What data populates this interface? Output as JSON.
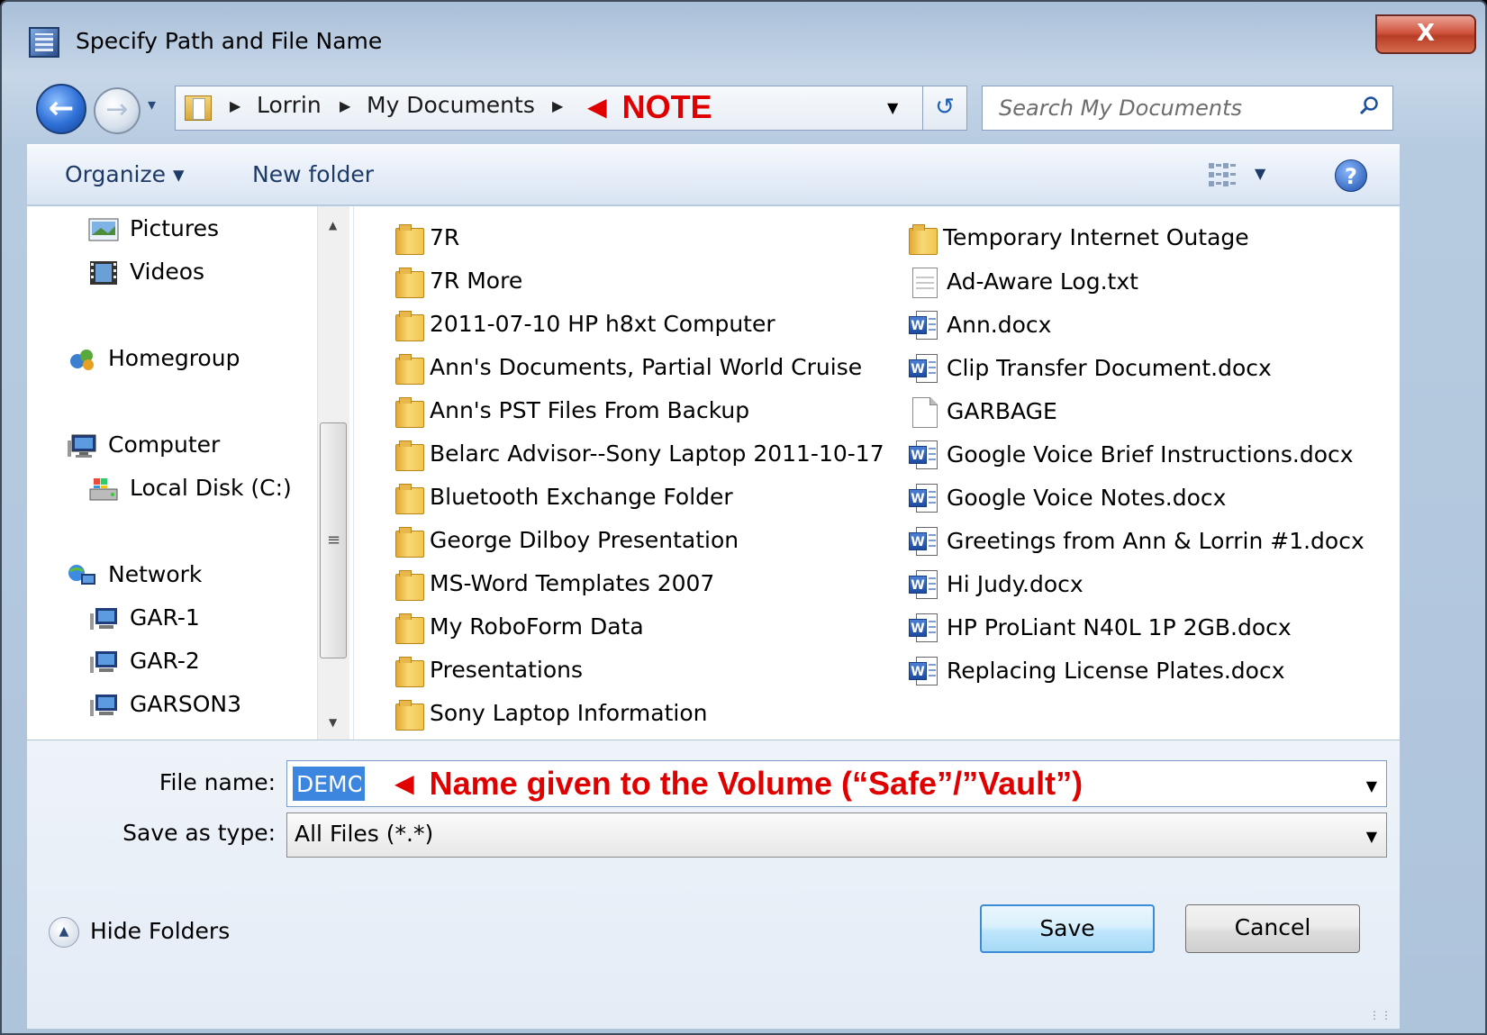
{
  "window": {
    "title": "Specify Path and File Name",
    "close_label": "X"
  },
  "address": {
    "crumbs": [
      "Lorrin",
      "My Documents"
    ],
    "note_annotation": "◄ NOTE"
  },
  "search": {
    "placeholder": "Search My Documents"
  },
  "toolbar": {
    "organize_label": "Organize ▾",
    "new_folder_label": "New folder",
    "help_label": "?"
  },
  "nav_pane": {
    "items": [
      {
        "label": "Pictures",
        "icon": "pictures-icon"
      },
      {
        "label": "Videos",
        "icon": "videos-icon"
      },
      {
        "label": "Homegroup",
        "icon": "homegroup-icon"
      },
      {
        "label": "Computer",
        "icon": "computer-icon"
      },
      {
        "label": "Local Disk (C:)",
        "icon": "local-disk-icon"
      },
      {
        "label": "Network",
        "icon": "network-icon"
      },
      {
        "label": "GAR-1",
        "icon": "network-computer-icon"
      },
      {
        "label": "GAR-2",
        "icon": "network-computer-icon"
      },
      {
        "label": "GARSON3",
        "icon": "network-computer-icon"
      }
    ]
  },
  "files": {
    "column1": [
      {
        "name": "7R",
        "type": "folder"
      },
      {
        "name": "7R More",
        "type": "folder"
      },
      {
        "name": "2011-07-10 HP h8xt Computer",
        "type": "folder"
      },
      {
        "name": "Ann's Documents, Partial World Cruise",
        "type": "folder"
      },
      {
        "name": "Ann's PST Files From Backup",
        "type": "folder"
      },
      {
        "name": "Belarc Advisor--Sony Laptop 2011-10-17",
        "type": "folder"
      },
      {
        "name": "Bluetooth Exchange Folder",
        "type": "folder"
      },
      {
        "name": "George Dilboy Presentation",
        "type": "folder"
      },
      {
        "name": "MS-Word Templates 2007",
        "type": "folder"
      },
      {
        "name": "My RoboForm Data",
        "type": "folder"
      },
      {
        "name": "Presentations",
        "type": "folder"
      },
      {
        "name": "Sony Laptop Information",
        "type": "folder"
      }
    ],
    "column2": [
      {
        "name": "Temporary Internet Outage",
        "type": "folder"
      },
      {
        "name": "Ad-Aware Log.txt",
        "type": "txt"
      },
      {
        "name": "Ann.docx",
        "type": "docx"
      },
      {
        "name": "Clip Transfer Document.docx",
        "type": "docx"
      },
      {
        "name": "GARBAGE",
        "type": "blank"
      },
      {
        "name": "Google Voice Brief Instructions.docx",
        "type": "docx"
      },
      {
        "name": "Google Voice Notes.docx",
        "type": "docx"
      },
      {
        "name": "Greetings from Ann & Lorrin #1.docx",
        "type": "docx"
      },
      {
        "name": "Hi Judy.docx",
        "type": "docx"
      },
      {
        "name": "HP ProLiant N40L 1P 2GB.docx",
        "type": "docx"
      },
      {
        "name": "Replacing License Plates.docx",
        "type": "docx"
      }
    ]
  },
  "form": {
    "file_name_label": "File name:",
    "file_name_value": "DEMO",
    "file_name_annotation": "◄ Name given to the Volume (“Safe”/”Vault”)",
    "save_type_label": "Save as type:",
    "save_type_value": "All Files (*.*)"
  },
  "footer": {
    "hide_folders_label": "Hide Folders",
    "save_label": "Save",
    "cancel_label": "Cancel"
  },
  "colors": {
    "annotation": "#e00000",
    "accent": "#3d86e0"
  }
}
